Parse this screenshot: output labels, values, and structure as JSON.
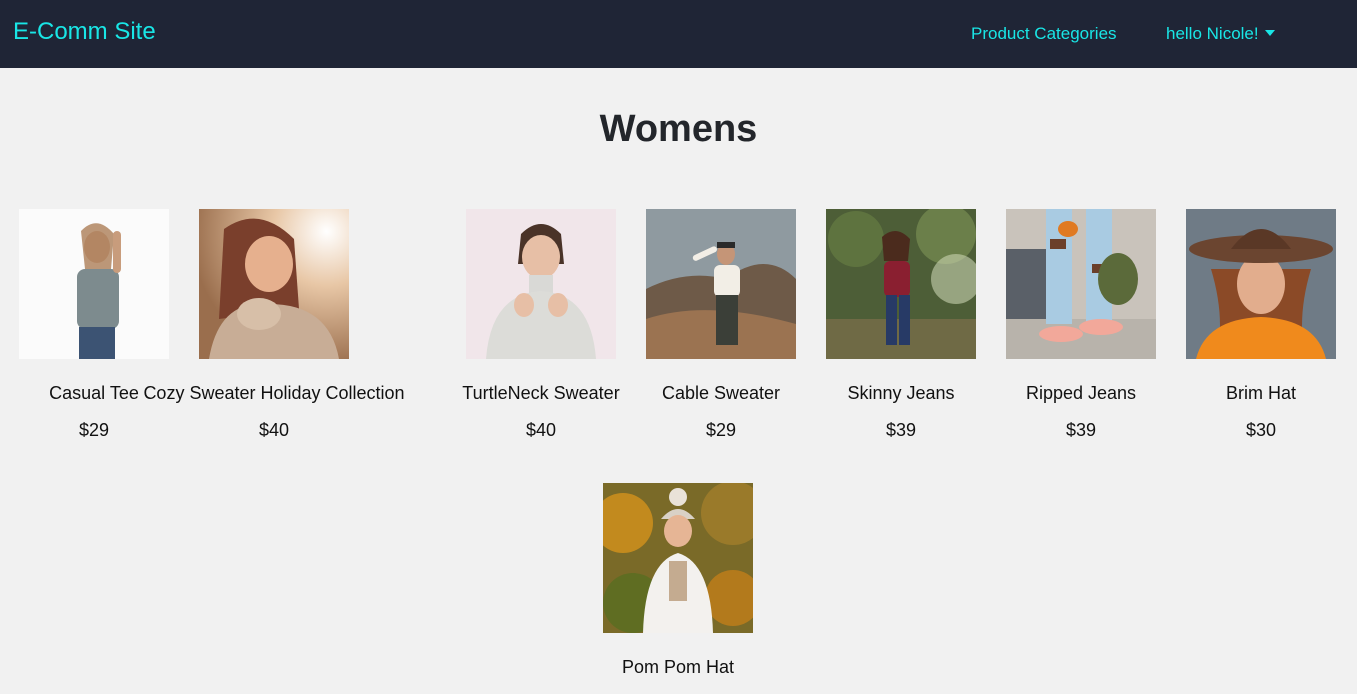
{
  "navbar": {
    "brand": "E-Comm Site",
    "categories_label": "Product Categories",
    "user_label": "hello Nicole!"
  },
  "page": {
    "title": "Womens"
  },
  "products": [
    {
      "name": "Casual Tee",
      "price": "$29"
    },
    {
      "name": "Cozy Sweater Holiday Collection",
      "price": "$40"
    },
    {
      "name": "TurtleNeck Sweater",
      "price": "$40"
    },
    {
      "name": "Cable Sweater",
      "price": "$29"
    },
    {
      "name": "Skinny Jeans",
      "price": "$39"
    },
    {
      "name": "Ripped Jeans",
      "price": "$39"
    },
    {
      "name": "Brim Hat",
      "price": "$30"
    },
    {
      "name": "Pom Pom Hat",
      "price": ""
    }
  ],
  "colors": {
    "navbar_bg": "#1f2536",
    "accent": "#19e6e6",
    "page_bg": "#f1f1f1"
  }
}
